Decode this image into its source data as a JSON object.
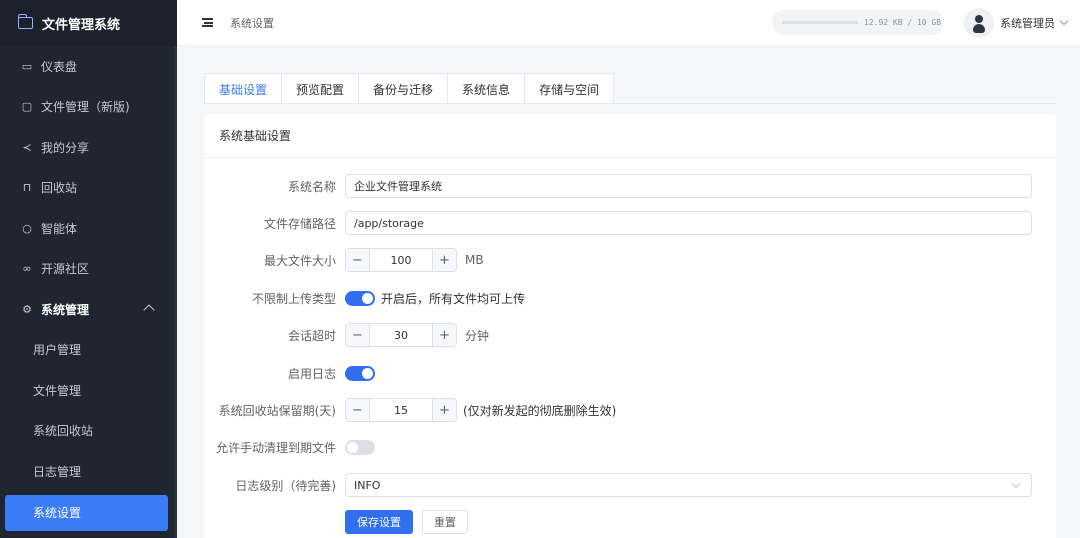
{
  "app": {
    "title": "文件管理系统"
  },
  "sidebar": {
    "items": [
      {
        "label": "仪表盘",
        "icon": "dashboard-icon"
      },
      {
        "label": "文件管理（新版)",
        "icon": "folder-icon"
      },
      {
        "label": "我的分享",
        "icon": "share-icon"
      },
      {
        "label": "回收站",
        "icon": "trash-icon"
      },
      {
        "label": "智能体",
        "icon": "chat-icon"
      },
      {
        "label": "开源社区",
        "icon": "link-icon"
      },
      {
        "label": "系统管理",
        "icon": "gear-icon"
      }
    ],
    "sub_items": [
      {
        "label": "用户管理"
      },
      {
        "label": "文件管理"
      },
      {
        "label": "系统回收站"
      },
      {
        "label": "日志管理"
      },
      {
        "label": "系统设置"
      }
    ]
  },
  "header": {
    "breadcrumb": "系统设置",
    "storage_text": "12.92 KB / 10 GB",
    "storage_used_fraction": 0.0,
    "user_name": "系统管理员"
  },
  "tabs": [
    {
      "label": "基础设置"
    },
    {
      "label": "预览配置"
    },
    {
      "label": "备份与迁移"
    },
    {
      "label": "系统信息"
    },
    {
      "label": "存储与空间"
    }
  ],
  "card": {
    "title": "系统基础设置"
  },
  "form": {
    "system_name": {
      "label": "系统名称",
      "value": "企业文件管理系统"
    },
    "storage_path": {
      "label": "文件存储路径",
      "value": "/app/storage"
    },
    "max_file_size": {
      "label": "最大文件大小",
      "value": "100",
      "unit": "MB"
    },
    "unlimited_upload": {
      "label": "不限制上传类型",
      "on": true,
      "hint": "开启后，所有文件均可上传"
    },
    "session_timeout": {
      "label": "会话超时",
      "value": "30",
      "unit": "分钟"
    },
    "enable_log": {
      "label": "启用日志",
      "on": true
    },
    "recycle_retention": {
      "label": "系统回收站保留期(天)",
      "value": "15",
      "hint": "(仅对新发起的彻底删除生效)"
    },
    "manual_cleanup": {
      "label": "允许手动清理到期文件",
      "on": false
    },
    "log_level": {
      "label": "日志级别（待完善)",
      "value": "INFO"
    }
  },
  "buttons": {
    "save": "保存设置",
    "reset": "重置"
  },
  "colors": {
    "accent": "#2f6ff0",
    "sidebar_bg": "#1f2531",
    "active_item": "#3a7bf6"
  }
}
